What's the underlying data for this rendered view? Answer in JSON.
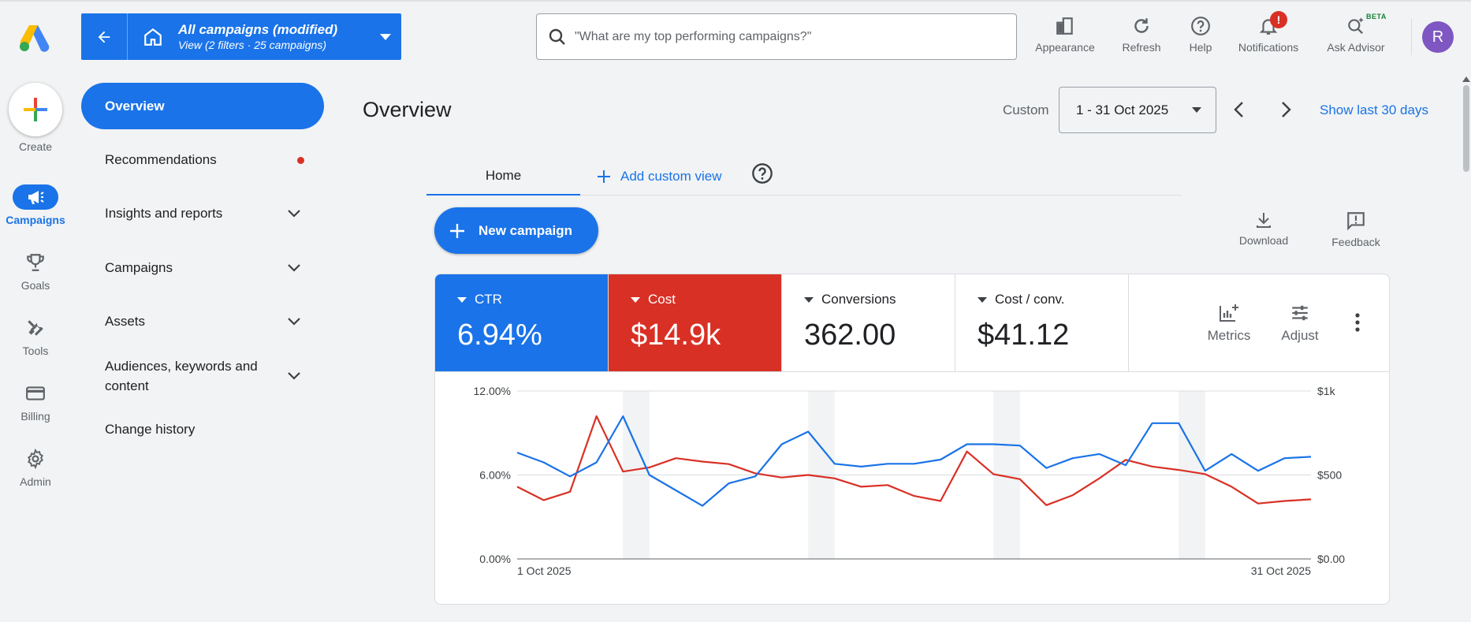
{
  "header": {
    "scope_title": "All campaigns (modified)",
    "scope_subtitle": "View (2 filters · 25 campaigns)",
    "search_placeholder": "\"What are my top performing campaigns?\"",
    "tools": [
      {
        "label": "Appearance",
        "icon": "appearance-icon"
      },
      {
        "label": "Refresh",
        "icon": "refresh-icon"
      },
      {
        "label": "Help",
        "icon": "help-icon"
      },
      {
        "label": "Notifications",
        "icon": "bell-icon",
        "badge": "!"
      },
      {
        "label": "Ask Advisor",
        "icon": "advisor-icon",
        "tag": "BETA"
      }
    ],
    "avatar_initial": "R"
  },
  "rail": {
    "create_label": "Create",
    "items": [
      {
        "label": "Campaigns",
        "icon": "megaphone-icon",
        "active": true
      },
      {
        "label": "Goals",
        "icon": "trophy-icon"
      },
      {
        "label": "Tools",
        "icon": "tools-icon"
      },
      {
        "label": "Billing",
        "icon": "credit-card-icon"
      },
      {
        "label": "Admin",
        "icon": "gear-icon"
      }
    ]
  },
  "sidebar": {
    "items": [
      {
        "label": "Overview",
        "active": true
      },
      {
        "label": "Recommendations",
        "dot": true
      },
      {
        "label": "Insights and reports",
        "expandable": true
      },
      {
        "label": "Campaigns",
        "expandable": true
      },
      {
        "label": "Assets",
        "expandable": true
      },
      {
        "label": "Audiences, keywords and content",
        "expandable": true
      },
      {
        "label": "Change history"
      }
    ]
  },
  "main": {
    "title": "Overview",
    "date_mode": "Custom",
    "date_range": "1 - 31 Oct 2025",
    "show_last": "Show last 30 days",
    "tabs": {
      "home": "Home",
      "add": "Add custom view"
    },
    "new_campaign": "New campaign",
    "actions": {
      "download": "Download",
      "feedback": "Feedback"
    }
  },
  "metrics": [
    {
      "label": "CTR",
      "value": "6.94%",
      "color": "#1a73e8"
    },
    {
      "label": "Cost",
      "value": "$14.9k",
      "color": "#d93025"
    },
    {
      "label": "Conversions",
      "value": "362.00"
    },
    {
      "label": "Cost / conv.",
      "value": "$41.12"
    }
  ],
  "card_tools": {
    "metrics": "Metrics",
    "adjust": "Adjust"
  },
  "chart_data": {
    "type": "line",
    "x_start_label": "1 Oct 2025",
    "x_end_label": "31 Oct 2025",
    "y_left_ticks": [
      "12.00%",
      "6.00%",
      "0.00%"
    ],
    "y_right_ticks": [
      "$1k",
      "$500",
      "$0.00"
    ],
    "ylim_left": [
      0,
      12
    ],
    "ylim_right": [
      0,
      1000
    ],
    "weekend_bands": [
      [
        4,
        5
      ],
      [
        11,
        12
      ],
      [
        18,
        19
      ],
      [
        25,
        26
      ]
    ],
    "series": [
      {
        "name": "CTR",
        "axis": "left",
        "color": "#1a73e8",
        "values": [
          7.6,
          6.9,
          5.9,
          6.9,
          10.2,
          6.0,
          4.9,
          3.8,
          5.4,
          5.9,
          8.2,
          9.1,
          6.8,
          6.6,
          6.8,
          6.8,
          7.1,
          8.2,
          8.2,
          8.1,
          6.5,
          7.2,
          7.5,
          6.7,
          9.7,
          9.7,
          6.3,
          7.5,
          6.3,
          7.2,
          7.3
        ]
      },
      {
        "name": "Cost",
        "axis": "right",
        "color": "#d93025",
        "values": [
          430,
          350,
          400,
          850,
          520,
          545,
          600,
          580,
          565,
          510,
          485,
          500,
          480,
          430,
          440,
          375,
          345,
          640,
          505,
          475,
          320,
          380,
          480,
          590,
          550,
          530,
          505,
          430,
          330,
          345,
          355
        ]
      }
    ]
  }
}
